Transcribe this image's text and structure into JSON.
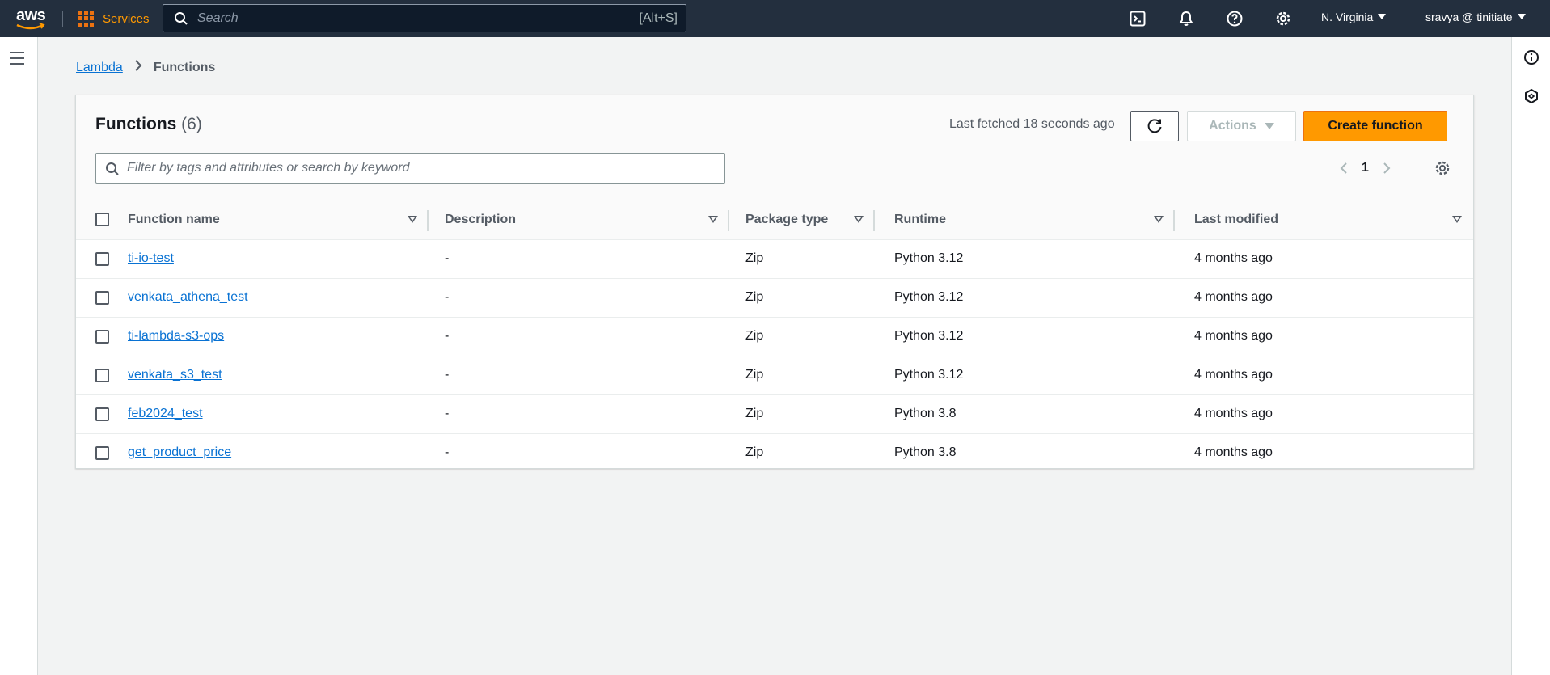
{
  "topnav": {
    "logo_text": "aws",
    "services_label": "Services",
    "search_placeholder": "Search",
    "search_shortcut": "[Alt+S]",
    "region": "N. Virginia",
    "user": "sravya @ tinitiate"
  },
  "breadcrumb": {
    "root": "Lambda",
    "current": "Functions"
  },
  "functions": {
    "title": "Functions",
    "count": "(6)",
    "last_fetched": "Last fetched 18 seconds ago",
    "actions_label": "Actions",
    "create_label": "Create function",
    "filter_placeholder": "Filter by tags and attributes or search by keyword",
    "page": "1",
    "columns": [
      "Function name",
      "Description",
      "Package type",
      "Runtime",
      "Last modified"
    ],
    "rows": [
      {
        "name": "ti-io-test",
        "description": "-",
        "package": "Zip",
        "runtime": "Python 3.12",
        "modified": "4 months ago"
      },
      {
        "name": "venkata_athena_test",
        "description": "-",
        "package": "Zip",
        "runtime": "Python 3.12",
        "modified": "4 months ago"
      },
      {
        "name": "ti-lambda-s3-ops",
        "description": "-",
        "package": "Zip",
        "runtime": "Python 3.12",
        "modified": "4 months ago"
      },
      {
        "name": "venkata_s3_test",
        "description": "-",
        "package": "Zip",
        "runtime": "Python 3.12",
        "modified": "4 months ago"
      },
      {
        "name": "feb2024_test",
        "description": "-",
        "package": "Zip",
        "runtime": "Python 3.8",
        "modified": "4 months ago"
      },
      {
        "name": "get_product_price",
        "description": "-",
        "package": "Zip",
        "runtime": "Python 3.8",
        "modified": "4 months ago"
      }
    ]
  },
  "colors": {
    "nav_bg": "#232f3e",
    "accent": "#ff9900",
    "link": "#0972d3"
  },
  "icons": [
    "grid-icon",
    "search-icon",
    "cloudshell-icon",
    "bell-icon",
    "help-icon",
    "gear-icon",
    "menu-icon",
    "info-icon",
    "hexagon-icon",
    "refresh-icon",
    "chevron-left-icon",
    "chevron-right-icon",
    "sort-icon"
  ]
}
